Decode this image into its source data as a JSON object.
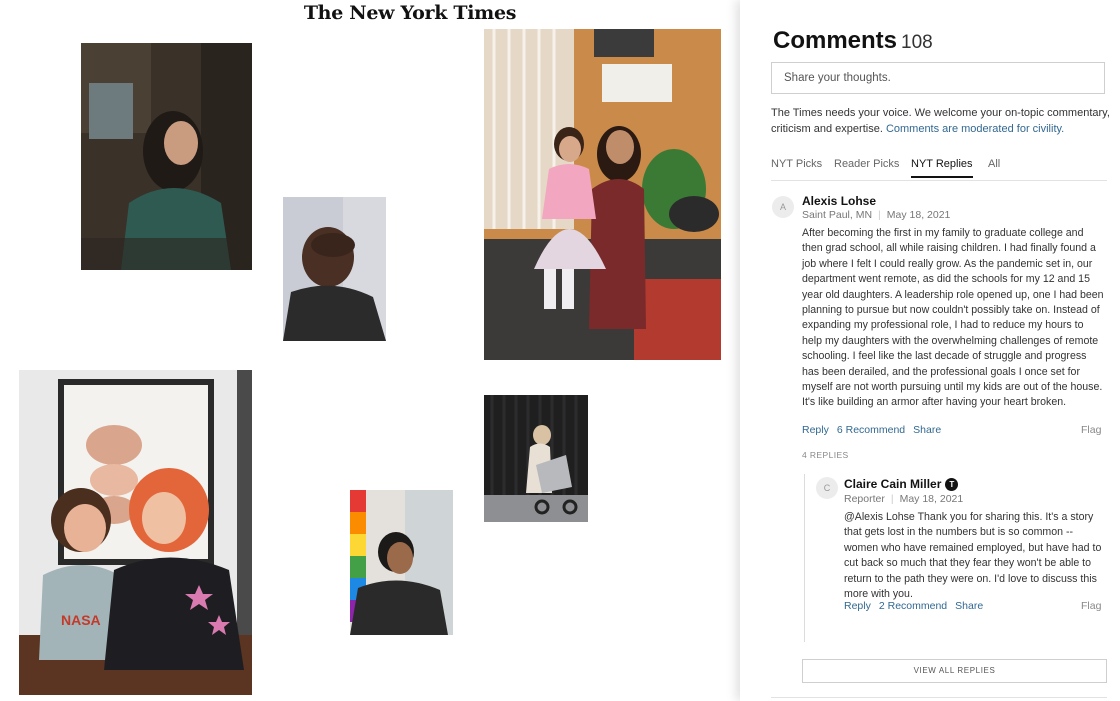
{
  "article": {
    "masthead": "The New York Times",
    "photos": [
      {
        "name": "photo-woman-seated-green-shirt"
      },
      {
        "name": "photo-person-covering-face"
      },
      {
        "name": "photo-mother-daughter-porch"
      },
      {
        "name": "photo-parent-child-nasa-shirt"
      },
      {
        "name": "photo-person-rainbow-flag"
      },
      {
        "name": "photo-woman-with-stroller"
      }
    ]
  },
  "comments": {
    "title": "Comments",
    "count": "108",
    "share_placeholder": "Share your thoughts.",
    "intro_text": "The Times needs your voice. We welcome your on-topic commentary, criticism and expertise. ",
    "intro_link": "Comments are moderated for civility.",
    "tabs": [
      "NYT Picks",
      "Reader Picks",
      "NYT Replies",
      "All"
    ],
    "active_tab": "NYT Replies",
    "items": [
      {
        "avatar": "A",
        "author": "Alexis Lohse",
        "location": "Saint Paul, MN",
        "date": "May 18, 2021",
        "text": "After becoming the first in my family to graduate college and then grad school, all while raising children. I had finally found a job where I felt I could really grow. As the pandemic set in, our department went remote, as did the schools for my 12 and 15 year old daughters. A leadership role opened up, one I had been planning to pursue but now couldn't possibly take on. Instead of expanding my professional role, I had to reduce my hours to help my daughters with the overwhelming challenges of remote schooling. I feel like the last decade of struggle and progress has been derailed, and the professional goals I once set for myself are not worth pursuing until my kids are out of the house. It's like building an armor after having your heart broken.",
        "reply_label": "Reply",
        "recommend_label": "6 Recommend",
        "share_label": "Share",
        "flag_label": "Flag",
        "replies_count": "4 REPLIES"
      }
    ],
    "reply": {
      "avatar": "C",
      "author": "Claire Cain Miller",
      "badge": "T",
      "role": "Reporter",
      "date": "May 18, 2021",
      "text": "@Alexis Lohse Thank you for sharing this. It's a story that gets lost in the numbers but is so common -- women who have remained employed, but have had to cut back so much that they fear they won't be able to return to the path they were on. I'd love to discuss this more with you.",
      "reply_label": "Reply",
      "recommend_label": "2 Recommend",
      "share_label": "Share",
      "flag_label": "Flag"
    },
    "view_all_label": "VIEW ALL REPLIES"
  }
}
